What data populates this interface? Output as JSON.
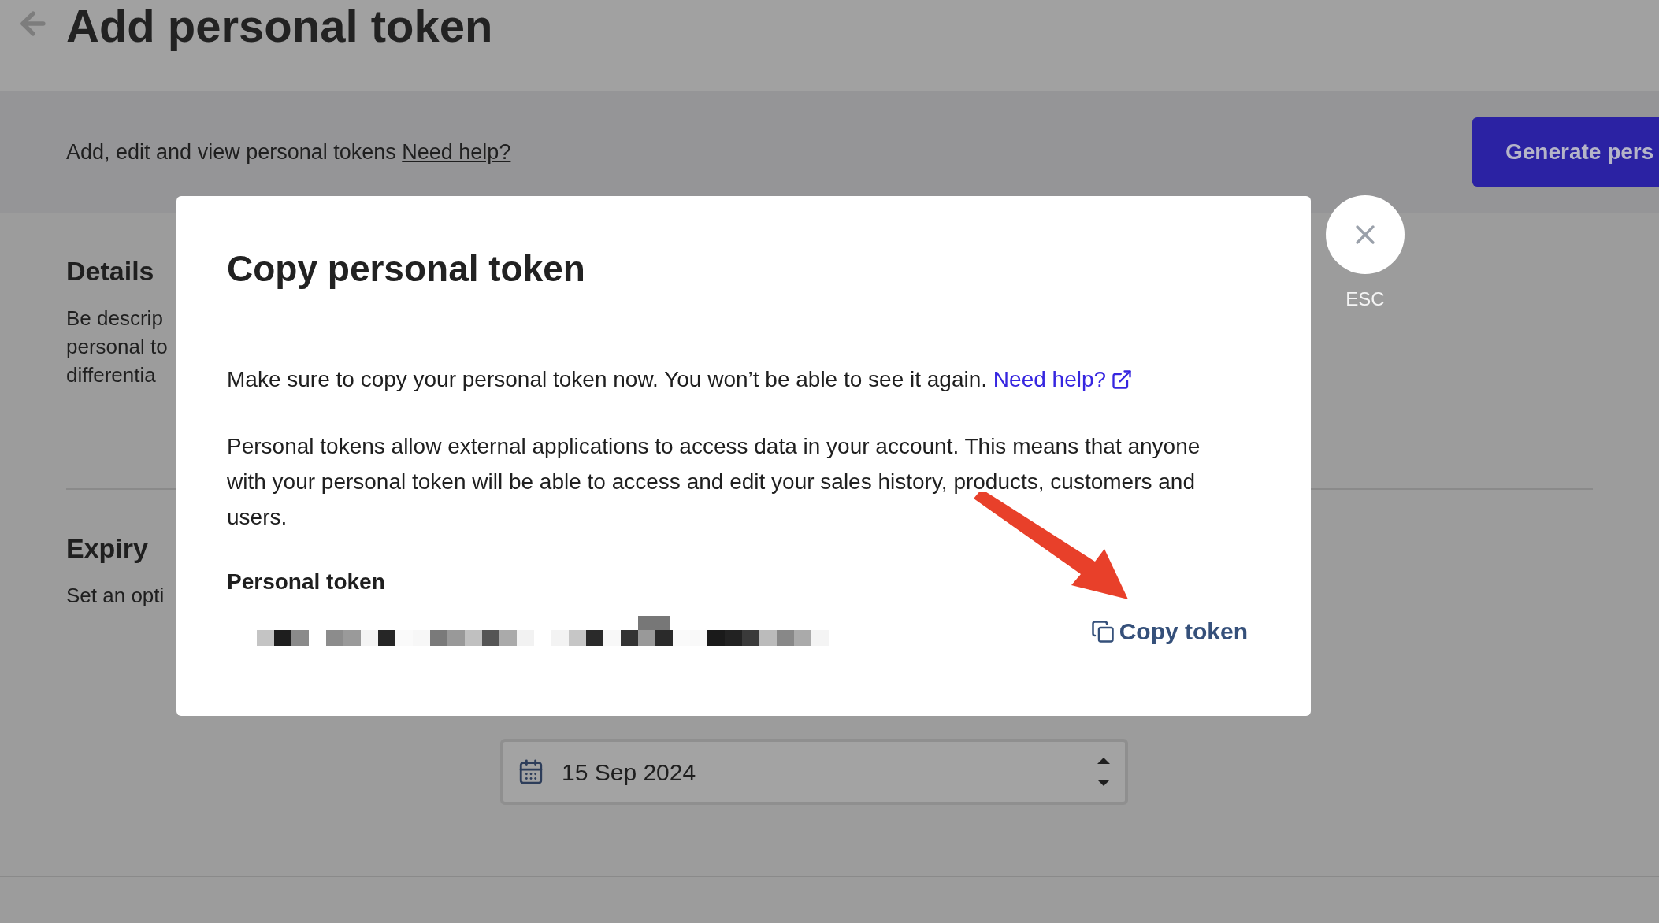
{
  "page": {
    "title": "Add personal token",
    "subtitle": "Add, edit and view personal tokens",
    "subtitle_link": "Need help?",
    "generate_button": "Generate pers",
    "sections": [
      {
        "heading": "Details",
        "description": [
          "Be descrip",
          "personal to",
          "differentia"
        ]
      },
      {
        "heading": "Expiry",
        "description": [
          "Set an opti"
        ]
      }
    ],
    "expiry_date": {
      "value": "15 Sep 2024"
    }
  },
  "modal": {
    "title": "Copy personal token",
    "warning": "Make sure to copy your personal token now. You won’t be able to see it again.",
    "help_link": "Need help?",
    "explanation": "Personal tokens allow external applications to access data in your account. This means that anyone with your personal token will be able to access and edit your sales history, products, customers and users.",
    "token_label": "Personal token",
    "copy_button": "Copy token",
    "close_hint": "ESC"
  }
}
